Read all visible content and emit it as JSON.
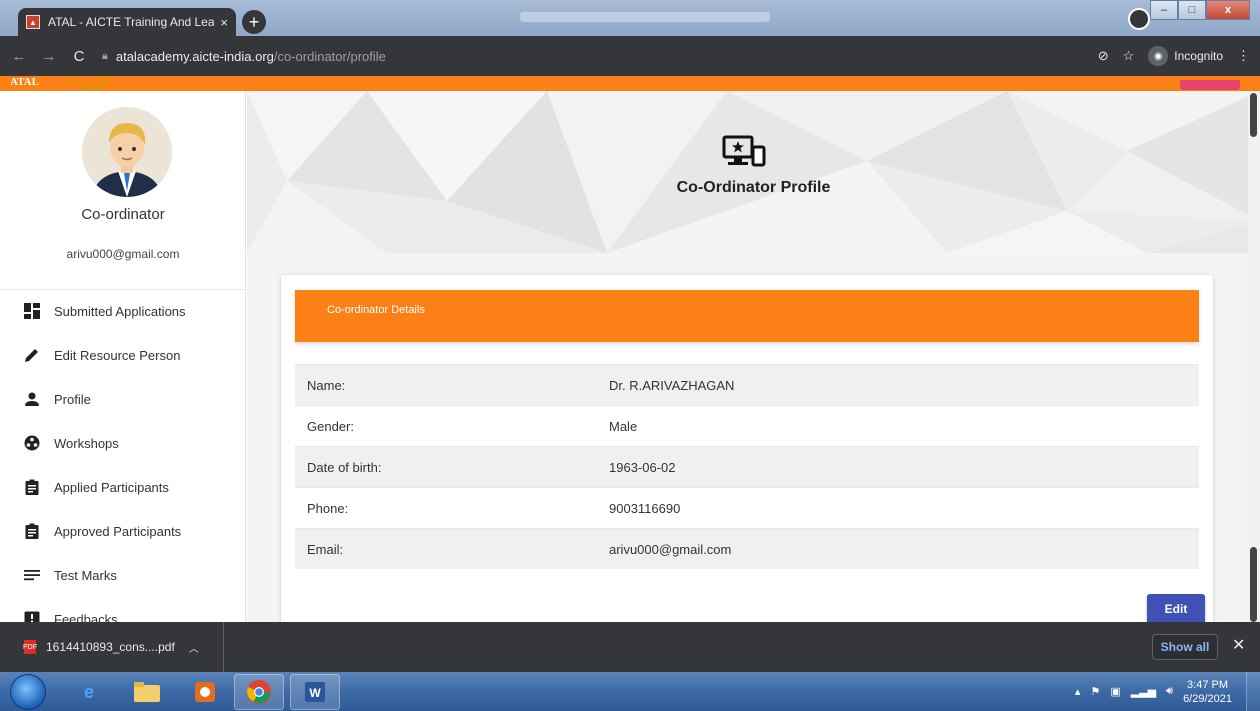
{
  "browser": {
    "tab_title": "ATAL - AICTE Training And Learni",
    "tab_close": "×",
    "new_tab": "+",
    "url_host": "atalacademy.aicte-india.org",
    "url_path": "/co-ordinator/profile",
    "incognito_label": "Incognito"
  },
  "site": {
    "logo_text": "ATAL"
  },
  "sidebar": {
    "role": "Co-ordinator",
    "email": "arivu000@gmail.com",
    "items": [
      {
        "label": "Submitted Applications",
        "icon": "dashboard-icon"
      },
      {
        "label": "Edit Resource Person",
        "icon": "pencil-icon"
      },
      {
        "label": "Profile",
        "icon": "person-icon"
      },
      {
        "label": "Workshops",
        "icon": "workshop-icon"
      },
      {
        "label": "Applied Participants",
        "icon": "assignment-icon"
      },
      {
        "label": "Approved Participants",
        "icon": "assignment-icon"
      },
      {
        "label": "Test Marks",
        "icon": "list-icon"
      },
      {
        "label": "Feedbacks",
        "icon": "feedback-icon"
      }
    ]
  },
  "hero": {
    "title": "Co-Ordinator Profile",
    "icon": "devices-star-icon"
  },
  "card": {
    "header": "Co-ordinator Details",
    "rows": [
      {
        "label": "Name:",
        "value": "Dr. R.ARIVAZHAGAN"
      },
      {
        "label": "Gender:",
        "value": "Male"
      },
      {
        "label": "Date of birth:",
        "value": "1963-06-02"
      },
      {
        "label": "Phone:",
        "value": "9003116690"
      },
      {
        "label": "Email:",
        "value": "arivu000@gmail.com"
      }
    ],
    "edit_label": "Edit"
  },
  "downloads": {
    "file_name": "1614410893_cons....pdf",
    "show_all": "Show all",
    "close": "✕"
  },
  "taskbar": {
    "time": "3:47 PM",
    "date": "6/29/2021"
  },
  "colors": {
    "accent_orange": "#fb8117",
    "edit_button": "#3f51b5",
    "browser_dark": "#35363a"
  }
}
